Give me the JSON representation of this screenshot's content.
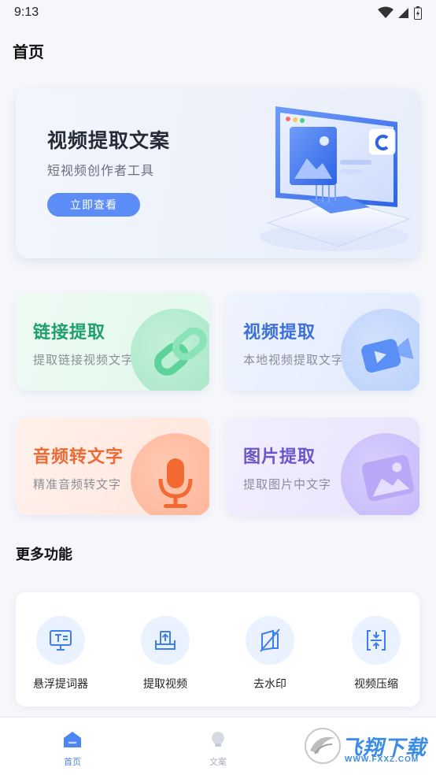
{
  "status_bar": {
    "time": "9:13"
  },
  "page": {
    "title": "首页"
  },
  "banner": {
    "title": "视频提取文案",
    "subtitle": "短视频创作者工具",
    "button": "立即查看"
  },
  "features": [
    {
      "title": "链接提取",
      "subtitle": "提取链接视频文字",
      "color": "#1f9e6e",
      "icon": "link-icon"
    },
    {
      "title": "视频提取",
      "subtitle": "本地视频提取文字",
      "color": "#3c6fd8",
      "icon": "video-icon"
    },
    {
      "title": "音频转文字",
      "subtitle": "精准音频转文字",
      "color": "#ee6a35",
      "icon": "microphone-icon"
    },
    {
      "title": "图片提取",
      "subtitle": "提取图片中文字",
      "color": "#6a55c9",
      "icon": "image-icon"
    }
  ],
  "more": {
    "title": "更多功能",
    "tools": [
      {
        "label": "悬浮提词器",
        "icon": "teleprompter-icon"
      },
      {
        "label": "提取视频",
        "icon": "upload-tray-icon"
      },
      {
        "label": "去水印",
        "icon": "remove-watermark-icon"
      },
      {
        "label": "视频压缩",
        "icon": "compress-icon"
      }
    ]
  },
  "tabbar": {
    "tabs": [
      {
        "label": "首页",
        "icon": "home-icon",
        "active": true
      },
      {
        "label": "文案",
        "icon": "bulb-icon",
        "active": false
      }
    ]
  },
  "watermark": {
    "text": "飞翔下载",
    "url": "WWW.FXXZ.COM"
  }
}
